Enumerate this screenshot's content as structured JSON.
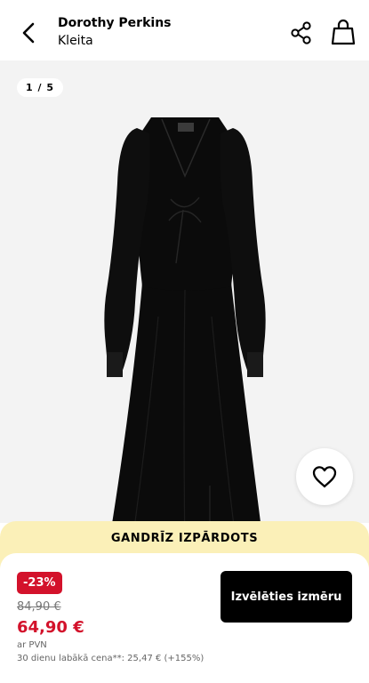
{
  "header": {
    "brand": "Dorothy Perkins",
    "product_type": "Kleita"
  },
  "icons": {
    "back": "chevron-left-icon",
    "share": "share-icon",
    "bag": "shopping-bag-icon",
    "favorite": "heart-outline-icon"
  },
  "gallery": {
    "counter": "1 / 5",
    "current_image": 1,
    "total_images": 5
  },
  "banner": {
    "text": "GANDRĪZ IZPĀRDOTS"
  },
  "pricing": {
    "discount_badge": "-23%",
    "old_price": "84,90 €",
    "new_price": "64,90 €",
    "vat_note": "ar PVN",
    "best_price_note": "30 dienu labākā cena**: 25,47 € (+155%)"
  },
  "actions": {
    "select_size_label": "Izvēlēties izmēru"
  },
  "colors": {
    "sale_red": "#d3122b",
    "banner_yellow": "#fbf0b8",
    "primary_button": "#000000",
    "gallery_background": "#f3f3f3"
  }
}
